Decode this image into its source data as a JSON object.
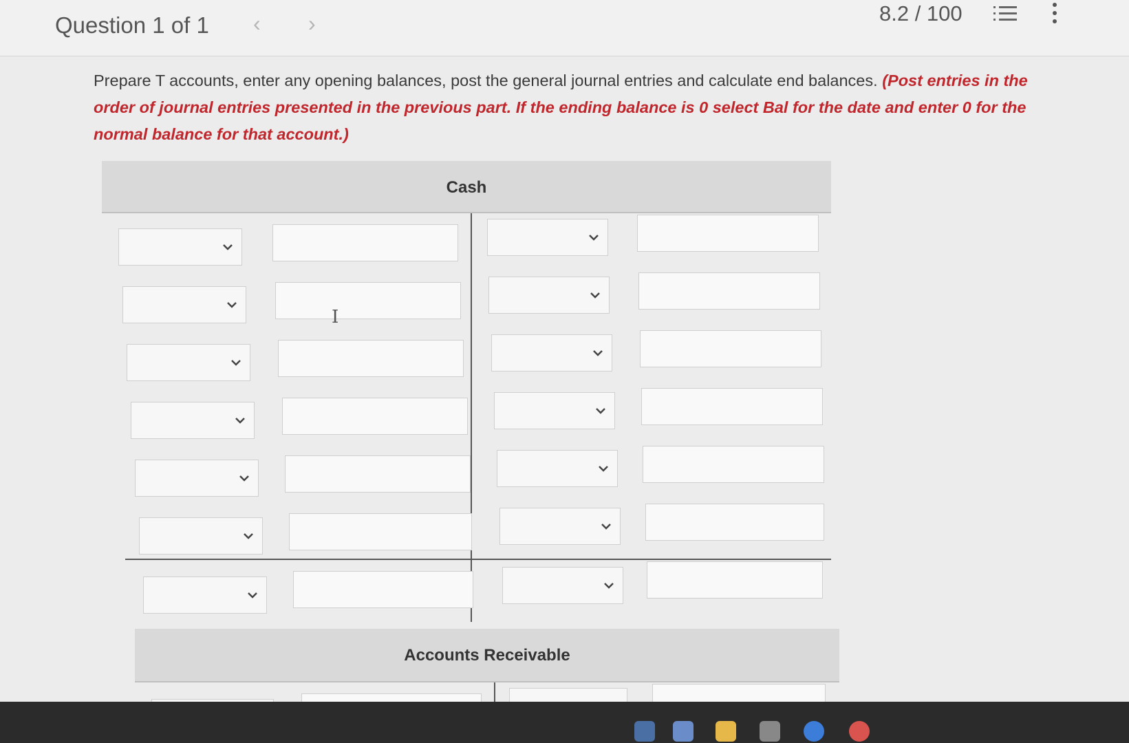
{
  "header": {
    "question_label": "Question 1 of 1",
    "prev_icon": "chevron-left-icon",
    "next_icon": "chevron-right-icon",
    "score": "8.2 / 100",
    "list_icon": "numbered-list-icon",
    "more_icon": "more-vertical-icon"
  },
  "instructions": {
    "text": "Prepare T accounts, enter any opening balances, post the general journal entries and calculate end balances.",
    "note": "(Post entries in the order of journal entries presented in the previous part. If the ending balance is 0 select Bal for the date and enter 0 for the normal balance for that account.)"
  },
  "accounts": [
    {
      "title": "Cash",
      "rows": 7
    },
    {
      "title": "Accounts Receivable",
      "rows": 1
    }
  ],
  "colors": {
    "accent_red": "#c0272d",
    "header_gray": "#d9d9d9",
    "page_bg": "#ececec"
  }
}
